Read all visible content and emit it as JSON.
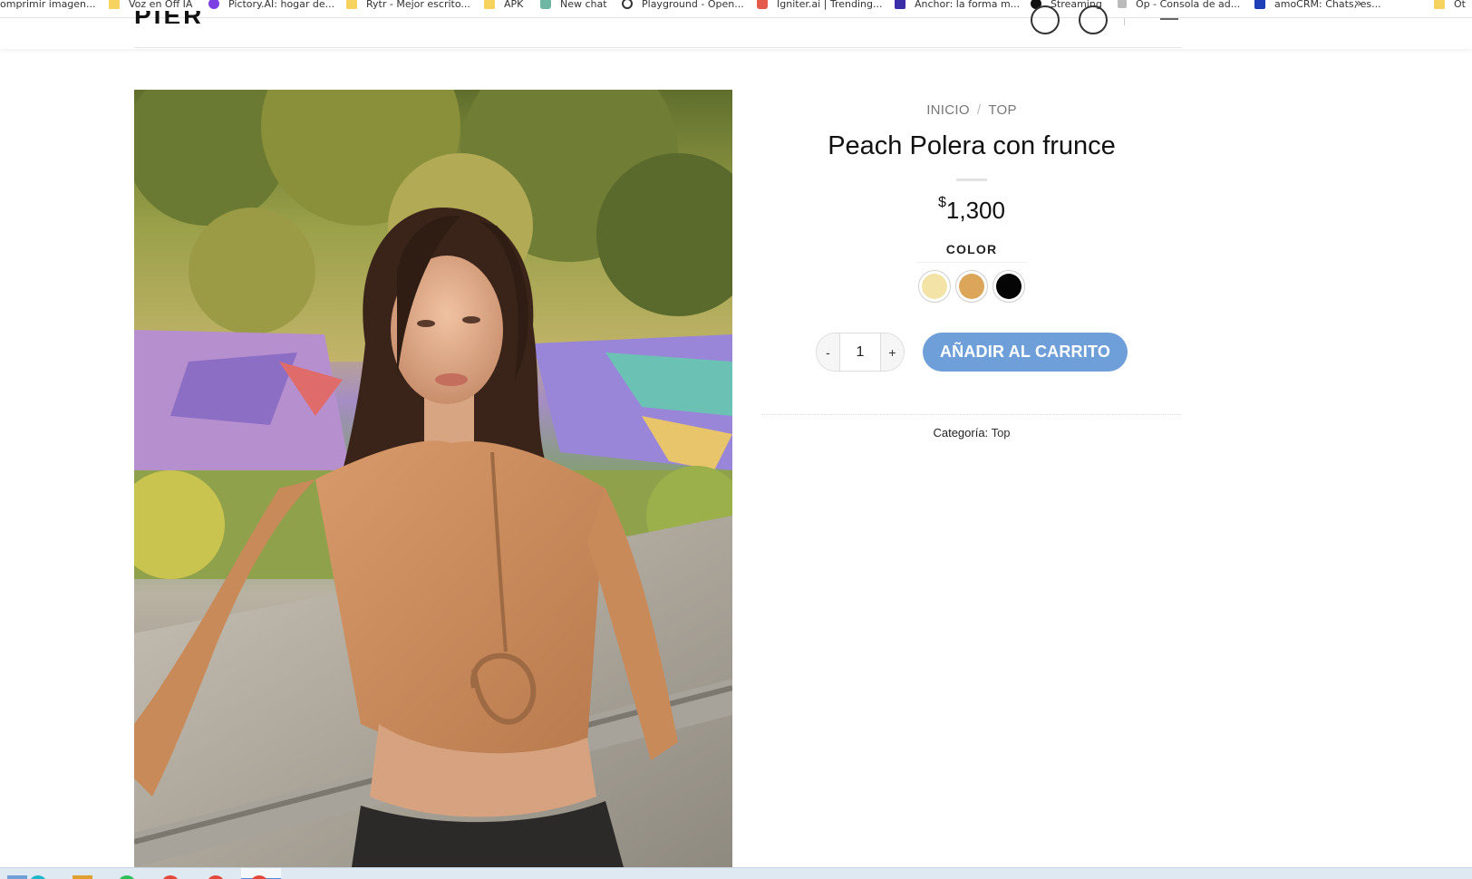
{
  "bookmarks": [
    {
      "label": "omprimir imagen...",
      "icon": "folder-icon"
    },
    {
      "label": "Voz en Off IA",
      "icon": "folder-icon"
    },
    {
      "label": "Pictory.AI: hogar de...",
      "icon": "pictory-icon"
    },
    {
      "label": "Rytr - Mejor escrito...",
      "icon": "folder-icon"
    },
    {
      "label": "APK",
      "icon": "folder-icon"
    },
    {
      "label": "New chat",
      "icon": "chatgpt-icon"
    },
    {
      "label": "Playground - Open...",
      "icon": "openai-icon"
    },
    {
      "label": "Igniter.ai | Trending...",
      "icon": "igniter-icon"
    },
    {
      "label": "Anchor: la forma m...",
      "icon": "anchor-icon"
    },
    {
      "label": "Streaming",
      "icon": "streaming-icon"
    },
    {
      "label": "Op - Consola de ad...",
      "icon": "plug-icon"
    },
    {
      "label": "amoCRM: Chats, es...",
      "icon": "amocrm-icon"
    },
    {
      "label": "Ot",
      "icon": "folder-icon"
    }
  ],
  "bookmarks_more": "»",
  "breadcrumb": {
    "home": "INICIO",
    "separator": "/",
    "category": "TOP"
  },
  "product": {
    "title": "Peach Polera con frunce",
    "currency_symbol": "$",
    "price": "1,300",
    "color_label": "COLOR",
    "colors": [
      {
        "name": "Crema",
        "hex": "#f3e3a6"
      },
      {
        "name": "Durazno",
        "hex": "#dca65a"
      },
      {
        "name": "Negro",
        "hex": "#050505"
      }
    ],
    "quantity": "1",
    "qty_minus": "-",
    "qty_plus": "+",
    "add_to_cart": "AÑADIR AL CARRITO",
    "category_label": "Categoría:",
    "category_value": "Top"
  },
  "colors": {
    "accent": "#6f9fd8",
    "text": "#111111",
    "muted": "#777777"
  }
}
